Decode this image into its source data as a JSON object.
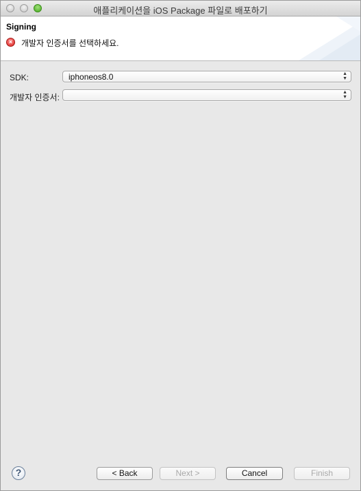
{
  "window": {
    "title": "애플리케이션을 iOS Package 파일로 배포하기"
  },
  "banner": {
    "title": "Signing",
    "message": "개발자 인증서를 선택하세요.",
    "error_icon": "error-x-icon"
  },
  "form": {
    "sdk_label": "SDK:",
    "sdk_value": "iphoneos8.0",
    "cert_label": "개발자 인증서:",
    "cert_value": ""
  },
  "buttons": {
    "help": "?",
    "back": "< Back",
    "next": "Next >",
    "cancel": "Cancel",
    "finish": "Finish"
  },
  "colors": {
    "error": "#d9221e",
    "window_bg": "#e8e8e8",
    "banner_bg": "#ffffff",
    "zoom_button": "#46a81d"
  }
}
